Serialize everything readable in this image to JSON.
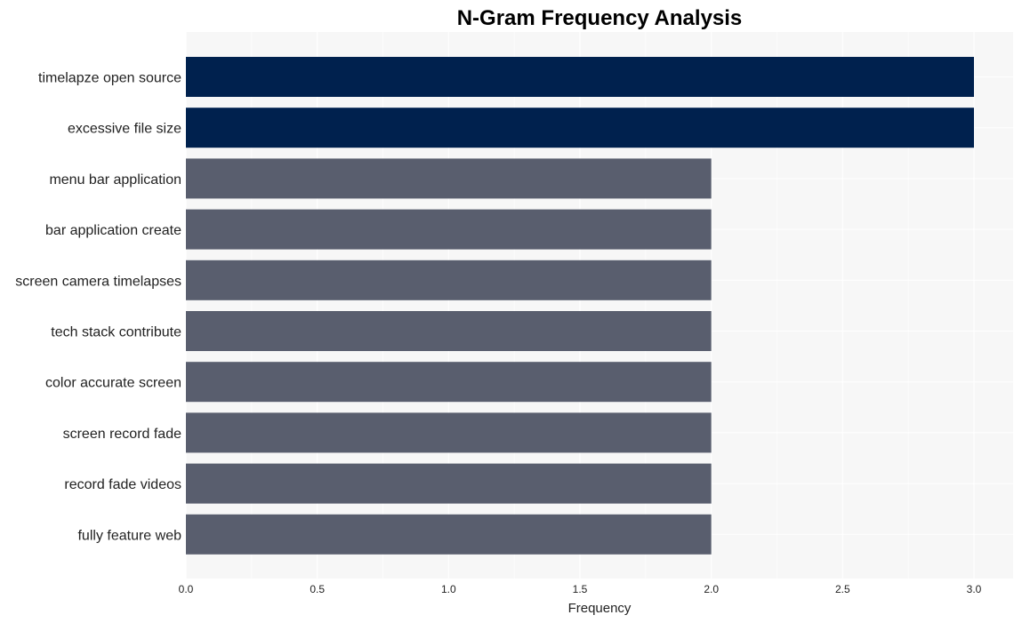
{
  "chart_data": {
    "type": "bar",
    "orientation": "horizontal",
    "title": "N-Gram Frequency Analysis",
    "xlabel": "Frequency",
    "ylabel": "",
    "categories": [
      "timelapze open source",
      "excessive file size",
      "menu bar application",
      "bar application create",
      "screen camera timelapses",
      "tech stack contribute",
      "color accurate screen",
      "screen record fade",
      "record fade videos",
      "fully feature web"
    ],
    "values": [
      3,
      3,
      2,
      2,
      2,
      2,
      2,
      2,
      2,
      2
    ],
    "xlim": [
      0,
      3.15
    ],
    "xticks": [
      0.0,
      0.5,
      1.0,
      1.5,
      2.0,
      2.5,
      3.0
    ],
    "xtick_labels": [
      "0.0",
      "0.5",
      "1.0",
      "1.5",
      "2.0",
      "2.5",
      "3.0"
    ],
    "grid": true,
    "legend": "none",
    "colors": {
      "highlight": "#00214e",
      "default": "#595e6e",
      "plot_background": "#f7f7f7",
      "grid": "#ffffff"
    }
  }
}
